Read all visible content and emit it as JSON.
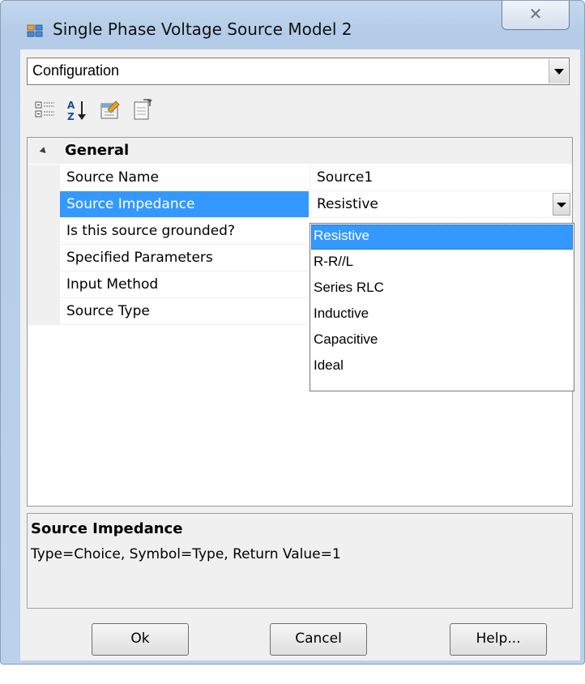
{
  "window": {
    "title": "Single Phase Voltage Source Model 2",
    "close_glyph": "✕"
  },
  "object_selector": {
    "selected": "Configuration"
  },
  "toolbar": {
    "icons": [
      "categorized-icon",
      "alphabetical-sort-icon",
      "property-pages-icon",
      "events-icon"
    ]
  },
  "property_grid": {
    "category": "General",
    "properties": [
      {
        "name": "Source Name",
        "value": "Source1"
      },
      {
        "name": "Source Impedance",
        "value": "Resistive"
      },
      {
        "name": "Is this source grounded?",
        "value": ""
      },
      {
        "name": "Specified Parameters",
        "value": ""
      },
      {
        "name": "Input Method",
        "value": ""
      },
      {
        "name": "Source Type",
        "value": ""
      }
    ],
    "selected_property": "Source Impedance"
  },
  "impedance_dropdown": {
    "options": [
      "Resistive",
      "R-R//L",
      "Series RLC",
      "Inductive",
      "Capacitive",
      "Ideal"
    ],
    "selected": "Resistive"
  },
  "help_panel": {
    "title": "Source Impedance",
    "description": "Type=Choice, Symbol=Type, Return Value=1"
  },
  "buttons": {
    "ok": "Ok",
    "cancel": "Cancel",
    "help": "Help..."
  },
  "colors": {
    "selection": "#3399ff",
    "title_bar": "#b9d1ea"
  }
}
